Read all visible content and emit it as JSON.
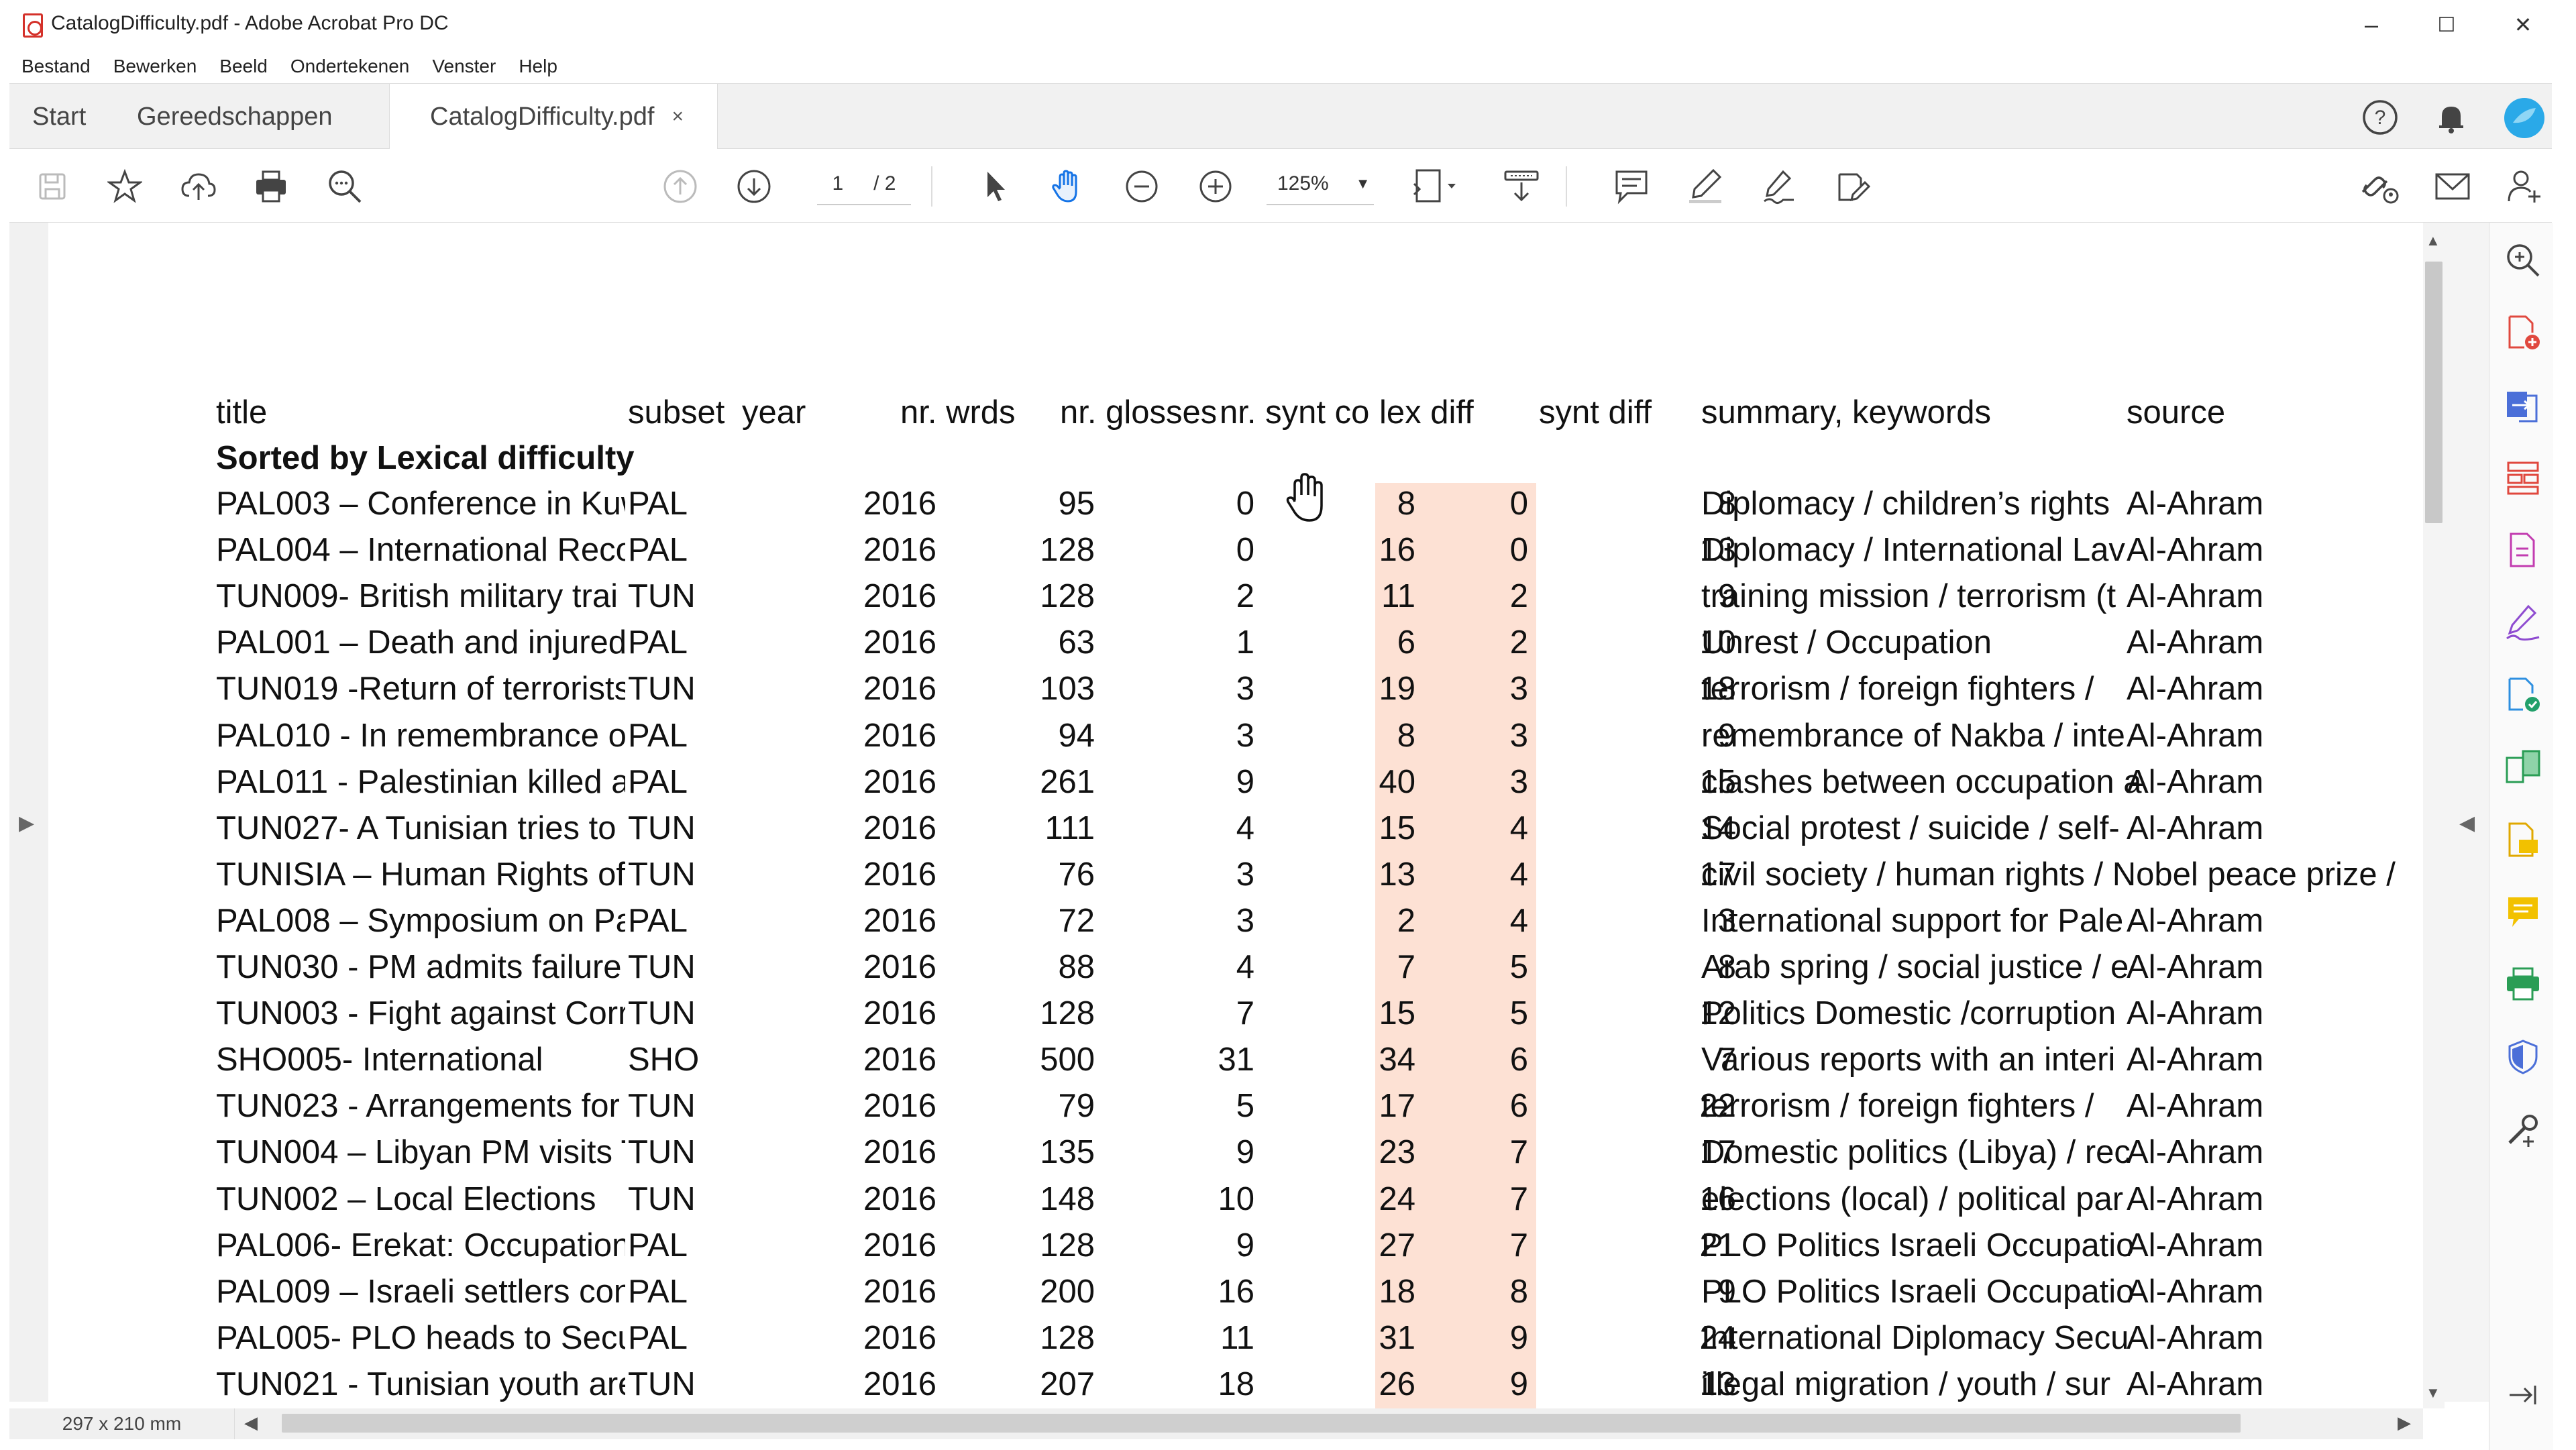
{
  "window": {
    "title": "CatalogDifficulty.pdf - Adobe Acrobat Pro DC",
    "minimize": "–",
    "maximize": "☐",
    "close": "✕"
  },
  "menu": [
    "Bestand",
    "Bewerken",
    "Beeld",
    "Ondertekenen",
    "Venster",
    "Help"
  ],
  "tabs": {
    "start": "Start",
    "tools": "Gereedschappen",
    "doc": "CatalogDifficulty.pdf",
    "doc_close": "×"
  },
  "toolbar": {
    "page_current": "1",
    "page_total": "/ 2",
    "zoom": "125%"
  },
  "status": {
    "page_size": "297 x 210 mm"
  },
  "table": {
    "headers": [
      "title",
      "subset",
      "year",
      "nr. wrds",
      "nr. glosses",
      "nr. synt co",
      "lex diff",
      "synt diff",
      "summary, keywords",
      "source"
    ],
    "section_label": "Sorted by Lexical difficulty",
    "rows": [
      [
        "PAL003 – Conference in Kuw",
        "PAL",
        "2016",
        "95",
        "0",
        "8",
        "0",
        "8",
        "Diplomacy / children’s rights",
        "Al-Ahram"
      ],
      [
        "PAL004 – International Reco",
        "PAL",
        "2016",
        "128",
        "0",
        "16",
        "0",
        "13",
        "Diplomacy / International Lav",
        "Al-Ahram"
      ],
      [
        "TUN009- British military trai",
        "TUN",
        "2016",
        "128",
        "2",
        "11",
        "2",
        "9",
        "training mission / terrorism (t",
        "Al-Ahram"
      ],
      [
        "PAL001 – Death and injured",
        "PAL",
        "2016",
        "63",
        "1",
        "6",
        "2",
        "10",
        "Unrest / Occupation",
        "Al-Ahram"
      ],
      [
        "TUN019 -Return of terrorists",
        "TUN",
        "2016",
        "103",
        "3",
        "19",
        "3",
        "18",
        "terrorism / foreign fighters /",
        "Al-Ahram"
      ],
      [
        "PAL010 - In remembrance o",
        "PAL",
        "2016",
        "94",
        "3",
        "8",
        "3",
        "9",
        "remembrance of Nakba / inte",
        "Al-Ahram"
      ],
      [
        "PAL011 - Palestinian killed a",
        "PAL",
        "2016",
        "261",
        "9",
        "40",
        "3",
        "15",
        "clashes between occupation a",
        "Al-Ahram"
      ],
      [
        "TUN027- A Tunisian tries to",
        "TUN",
        "2016",
        "111",
        "4",
        "15",
        "4",
        "14",
        "Social protest / suicide / self-",
        "Al-Ahram"
      ],
      [
        "TUNISIA – Human Rights of I",
        "TUN",
        "2016",
        "76",
        "3",
        "13",
        "4",
        "17",
        "civil society / human rights / Nobel peace prize /",
        ""
      ],
      [
        "PAL008 – Symposium on Pal",
        "PAL",
        "2016",
        "72",
        "3",
        "2",
        "4",
        "3",
        "International support for Pale",
        "Al-Ahram"
      ],
      [
        "TUN030 - PM admits failure",
        "TUN",
        "2016",
        "88",
        "4",
        "7",
        "5",
        "8",
        "Arab spring / social justice / e",
        "Al-Ahram"
      ],
      [
        "TUN003 - Fight against Corru",
        "TUN",
        "2016",
        "128",
        "7",
        "15",
        "5",
        "12",
        "Politics Domestic /corruption",
        "Al-Ahram"
      ],
      [
        "SHO005- International",
        "SHO",
        "2016",
        "500",
        "31",
        "34",
        "6",
        "7",
        "Various reports with an interi",
        "Al-Ahram"
      ],
      [
        "TUN023 - Arrangements for",
        "TUN",
        "2016",
        "79",
        "5",
        "17",
        "6",
        "22",
        "terrorism / foreign fighters /",
        "Al-Ahram"
      ],
      [
        "TUN004 – Libyan PM visits T",
        "TUN",
        "2016",
        "135",
        "9",
        "23",
        "7",
        "17",
        "Domestic politics (Libya) / rec",
        "Al-Ahram"
      ],
      [
        "TUN002 – Local Elections",
        "TUN",
        "2016",
        "148",
        "10",
        "24",
        "7",
        "16",
        "elections (local) / political par",
        "Al-Ahram"
      ],
      [
        "PAL006- Erekat: Occupation",
        "PAL",
        "2016",
        "128",
        "9",
        "27",
        "7",
        "21",
        "PLO Politics Israeli Occupatio",
        "Al-Ahram"
      ],
      [
        "PAL009 – Israeli settlers con",
        "PAL",
        "2016",
        "200",
        "16",
        "18",
        "8",
        "9",
        "PLO Politics Israeli Occupatio",
        "Al-Ahram"
      ],
      [
        "PAL005- PLO heads to Secur",
        "PAL",
        "2016",
        "128",
        "11",
        "31",
        "9",
        "24",
        "International Diplomacy Secu",
        "Al-Ahram"
      ],
      [
        "TUN021 - Tunisian youth are",
        "TUN",
        "2016",
        "207",
        "18",
        "26",
        "9",
        "13",
        "illegal migration / youth / sur",
        "Al-Ahram"
      ]
    ]
  },
  "colors": {
    "lex_highlight": "#fde1d4",
    "accent_blue": "#1473e6",
    "acrobat_red": "#d4312a"
  }
}
